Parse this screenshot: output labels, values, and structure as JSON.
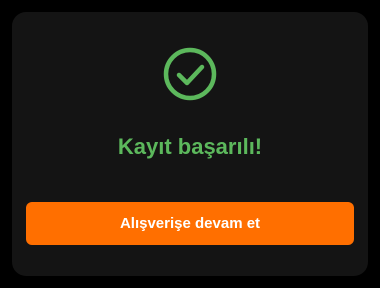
{
  "dialog": {
    "icon": "check-circle-icon",
    "title": "Kayıt başarılı!",
    "button_label": "Alışverişe devam et"
  },
  "colors": {
    "success": "#5cb85c",
    "accent": "#ff6f00",
    "dialog_background": "#141414",
    "page_background": "#000000"
  }
}
